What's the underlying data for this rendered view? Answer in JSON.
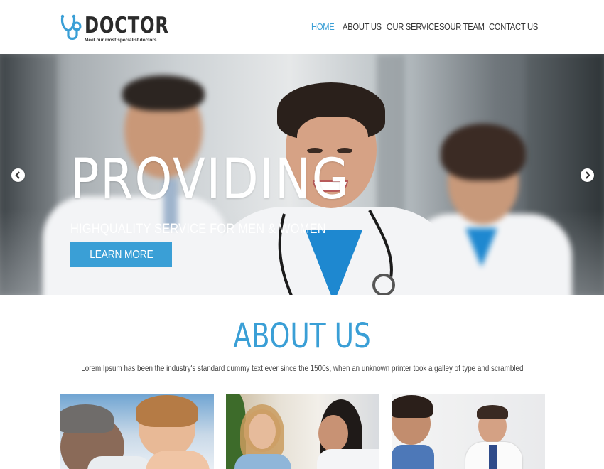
{
  "brand": {
    "name": "DOCTOR",
    "tagline": "Meet our most specialist doctors"
  },
  "nav": {
    "items": [
      {
        "label": "HOME",
        "active": true
      },
      {
        "label": "ABOUT US",
        "active": false
      },
      {
        "label": "OUR SERVICES",
        "active": false
      },
      {
        "label": "OUR TEAM",
        "active": false
      },
      {
        "label": "CONTACT US",
        "active": false
      }
    ]
  },
  "hero": {
    "title": "PROVIDING",
    "subtitle": "HIGHQUALITY SERVICE FOR MEN & WOMEN",
    "button_label": "LEARN MORE",
    "prev_icon": "chevron-left-icon",
    "next_icon": "chevron-right-icon"
  },
  "about": {
    "title": "ABOUT US",
    "text": "Lorem Ipsum has been the industry's standard dummy text ever since the 1500s, when an unknown printer took a galley of type and scrambled"
  },
  "colors": {
    "accent": "#3a9fd6",
    "text_dark": "#333333",
    "white": "#ffffff"
  }
}
